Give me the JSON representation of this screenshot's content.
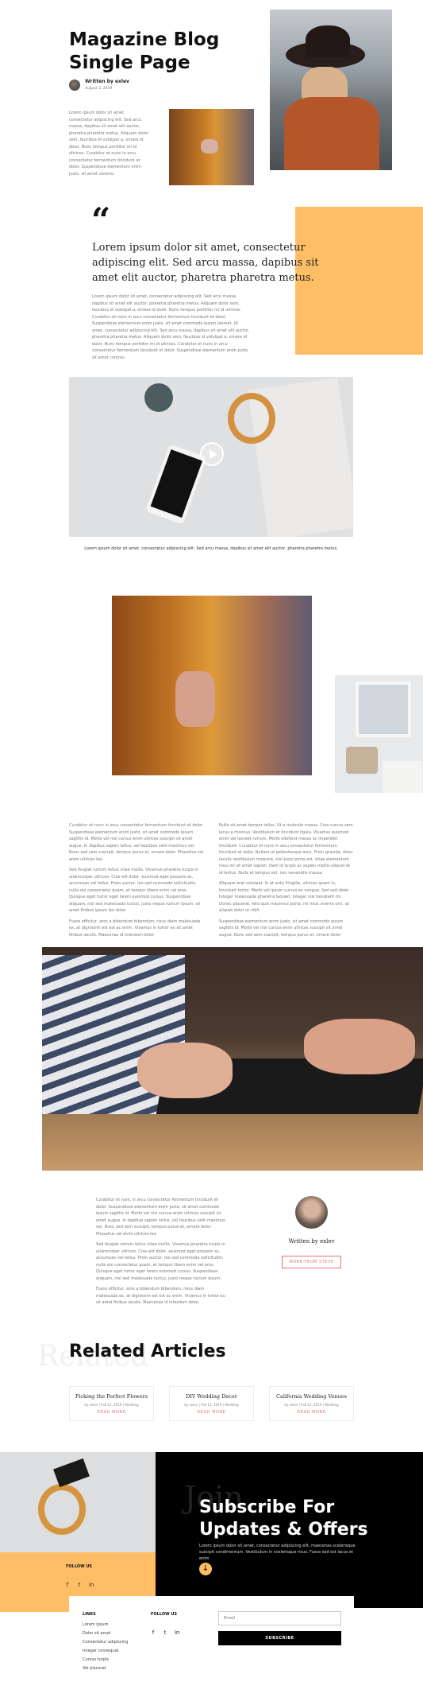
{
  "colors": {
    "accent": "#ffbe66",
    "dark": "#000000",
    "link": "#e57373"
  },
  "header": {
    "title": "Magazine Blog Single Page",
    "author_line": "Written by exlev",
    "date": "August 3, 2019"
  },
  "intro": {
    "paragraph": "Lorem ipsum dolor sit amet, consectetur adipiscing elit. Sed arcu massa, dapibus sit amet elit auctor, pharetra pharetra metus. Aliquam dolor sem, faucibus id volutpat a, ornare id dolor. Nunc tempus porttitor mi id ultrices. Curabitur et nunc in arcu consectetur fermentum tincidunt et dolor. Suspendisse elementum enim justo, sit amet commo."
  },
  "quote": {
    "mark": "“",
    "text": "Lorem ipsum dolor sit amet, consectetur adipiscing elit. Sed arcu massa, dapibus sit amet elit auctor, pharetra pharetra metus.",
    "paragraph": "Lorem ipsum dolor sit amet, consectetur adipiscing elit. Sed arcu massa, dapibus sit amet elit auctor, pharetra pharetra metus. Aliquam dolor sem, faucibus id volutpat a, ornare id dolor. Nunc tempus porttitor mi id ultrices. Curabitur et nunc in arcu consectetur fermentum tincidunt et dolor. Suspendisse elementum enim justo, sit amet commodo ipsum laoreet, Ut amet, consectetur adipiscing elit. Sed arcu massa, dapibus sit amet elit auctor, pharetra pharetra metus. Aliquam dolor sem, faucibus id volutpat a, ornare id dolor. Nunc tempus porttitor mi id ultrices. Curabitur et nunc in arcu consectetur fermentum tincidunt et dolor. Suspendisse elementum enim justo, sit amet commo."
  },
  "video": {
    "caption": "Lorem ipsum dolor sit amet, consectetur adipiscing elit. Sed arcu massa, dapibus sit amet elit auctor, pharetra pharetra metus."
  },
  "columns": {
    "left": [
      "Curabitur et nunc in arcu consectetur fermentum tincidunt et dolor. Suspendisse elementum enim justo, sit amet commodo ipsum sagittis id. Morbi vel nisi cursus enim ultrices suscipit sit amet augue. In dapibus sapien tellus, vel faucibus velit maximus vel. Nunc sed sem suscipit, tempus purus et, ornare dolor. Phasellus vel enim ultrices leo.",
      "Sed feugiat rutrum tellus vitae mollis. Vivamus pharetra turpis in ullamcorper ultrices. Cras elit dolor, euismod eget posuere ac, accumsan vel tellus. Proin auctor, leo sed commodo sollicitudin, nulla dui consectetur quam, et tempor libero enim vel eros. Quisque eget tortor eget lorem euismod cursus. Suspendisse aliquam, nisl sed malesuada luctus, justo neque rutrum ipsum, sit amet finibus ipsum leo dolor.",
      "Fusce efficitur, eros a bibendum bibendum, risus diam malesuada ex, at dignissim est est ac enim. Vivamus in tortor eu sit amet finibus iaculis. Maecenas id interdum dolor."
    ],
    "right": [
      "Nulla sit amet tempor tellus. Ut a molestie massa. Cras cursus sem lacus a rhoncus. Vestibulum et tincidunt ligula. Vivamus euismod enim vel laoreet rutrum. Morbi eleifend massa ac imperdiet tincidunt. Curabitur et nunc in arcu consectetur fermentum tincidunt et dolor. Nullam ut pellentesque arcu. Proin gravida, dolor iaculis vestibulum molestie, nisl justo porta est, vitae elementum risus mi sit amet sapien. Nam id turpis ac sapien mattis aliquet et id lectus. Nulla et tempus est, nec venenatis massa.",
      "Aliquam erat volutpat. In at ante fringilla, ultrices quam in, tincidunt tortor. Morbi vel ipsum cursus ex congue. Sed sed dolor. Integer malesuada pharetra laoreet. Integer nisl hendrerit mi. Donec placerat, felis quis maximus porta, mi risus viverra orci, ac aliquet dolor ut nibh.",
      "Suspendisse elementum enim justo, sit amet commodo ipsum sagittis id. Morbi vel nisi cursus enim ultrices suscipit sit amet augue. Nunc sed sem suscipit, tempus purus et, ornare dolor."
    ]
  },
  "author": {
    "paragraphs": [
      "Curabitur et nunc in arcu consectetur fermentum tincidunt et dolor. Suspendisse elementum enim justo, sit amet commodo ipsum sagittis id. Morbi vel nisi cursus enim ultrices suscipit sit amet augue. In dapibus sapien tellus, vel faucibus velit maximus vel. Nunc sed sem suscipit, tempus purus et, ornare dolor. Phasellus vel enim ultrices leo.",
      "Sed feugiat rutrum tellus vitae mollis. Vivamus pharetra turpis in ullamcorper ultrices. Cras elit dolor, euismod eget posuere ac, accumsan vel tellus. Proin auctor, leo sed commodo sollicitudin, nulla dui consectetur quam, et tempor libero enim vel eros. Quisque eget tortor eget lorem euismod cursus. Suspendisse aliquam, nisl sed malesuada luctus, justo neque rutrum ipsum.",
      "Fusce efficitur, eros a bibendum bibendum, risus diam malesuada ex, at dignissim est est ac enim. Vivamus in tortor eu sit amet finibus iaculis. Maecenas id interdum dolor."
    ],
    "written_by": "Written by exlev",
    "more_button": "MORE FROM STEVE"
  },
  "related": {
    "ghost": "Related",
    "title": "Related Articles",
    "cards": [
      {
        "title": "Picking the Perfect Flowers",
        "meta": "by exlev | Feb 12, 2019 | Wedding",
        "link": "READ MORE"
      },
      {
        "title": "DIY Wedding Decor",
        "meta": "by exlev | Feb 12, 2019 | Wedding",
        "link": "READ MORE"
      },
      {
        "title": "California Wedding Venues",
        "meta": "by exlev | Feb 12, 2019 | Wedding",
        "link": "READ MORE"
      }
    ]
  },
  "subscribe": {
    "follow_label": "FOLLOW US",
    "ghost": "Join",
    "title": "Subscribe For Updates & Offers",
    "text": "Lorem ipsum dolor sit amet, consectetur adipiscing elit, maecenas scelerisque suscipit condimentum. Vestibulum in scelerisque risus. Fusce sed est lacus et enim.",
    "social_icons": [
      "facebook-icon",
      "twitter-icon",
      "linkedin-icon"
    ]
  },
  "footer": {
    "links_title": "LINKS",
    "links": [
      "Lorem ipsum",
      "Dolor sit amet",
      "Consectetur adipiscing",
      "Integer consequat",
      "Cursus turpis",
      "Vel placerat"
    ],
    "follow_title": "FOLLOW US",
    "email_placeholder": "Email",
    "subscribe_button": "SUBSCRIBE"
  }
}
